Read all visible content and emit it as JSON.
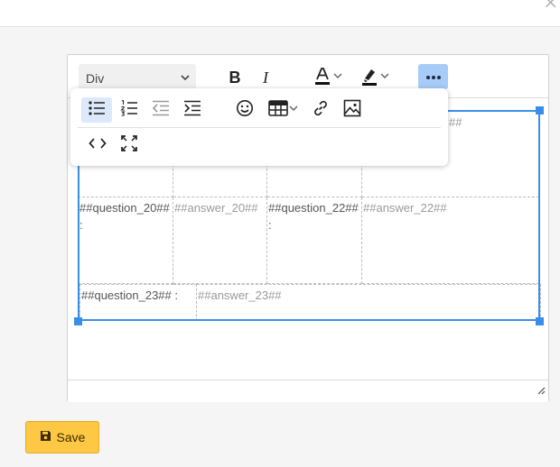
{
  "dialog": {
    "close_label": "×"
  },
  "toolbar": {
    "block_format": "Div",
    "buttons": [
      {
        "name": "bold",
        "icon": "bold-icon",
        "label": "B"
      },
      {
        "name": "italic",
        "icon": "italic-icon",
        "label": "I"
      },
      {
        "name": "text-color",
        "icon": "text-color-icon"
      },
      {
        "name": "highlight-color",
        "icon": "highlighter-icon"
      },
      {
        "name": "more",
        "icon": "more-dots-icon"
      }
    ]
  },
  "more_menu": {
    "row1": [
      "bullet-list-icon",
      "numbered-list-icon",
      "outdent-icon",
      "indent-icon",
      "emoji-icon",
      "table-icon",
      "link-icon",
      "image-icon"
    ],
    "row2": [
      "source-code-icon",
      "fullscreen-icon"
    ]
  },
  "table": {
    "row0": {
      "hidden_answer_tail": "##"
    },
    "row1": {
      "q1": "##question_20## :",
      "a1": "##answer_20##",
      "q2": "##question_22## :",
      "a2": "##answer_22##"
    },
    "row2": {
      "q1": "##question_23## :",
      "a1": "##answer_23##"
    }
  },
  "footer": {
    "save_label": "Save"
  },
  "colors": {
    "accent": "#3b8ee8",
    "save_bg": "#ffc844",
    "more_active": "#a6ccf7"
  }
}
